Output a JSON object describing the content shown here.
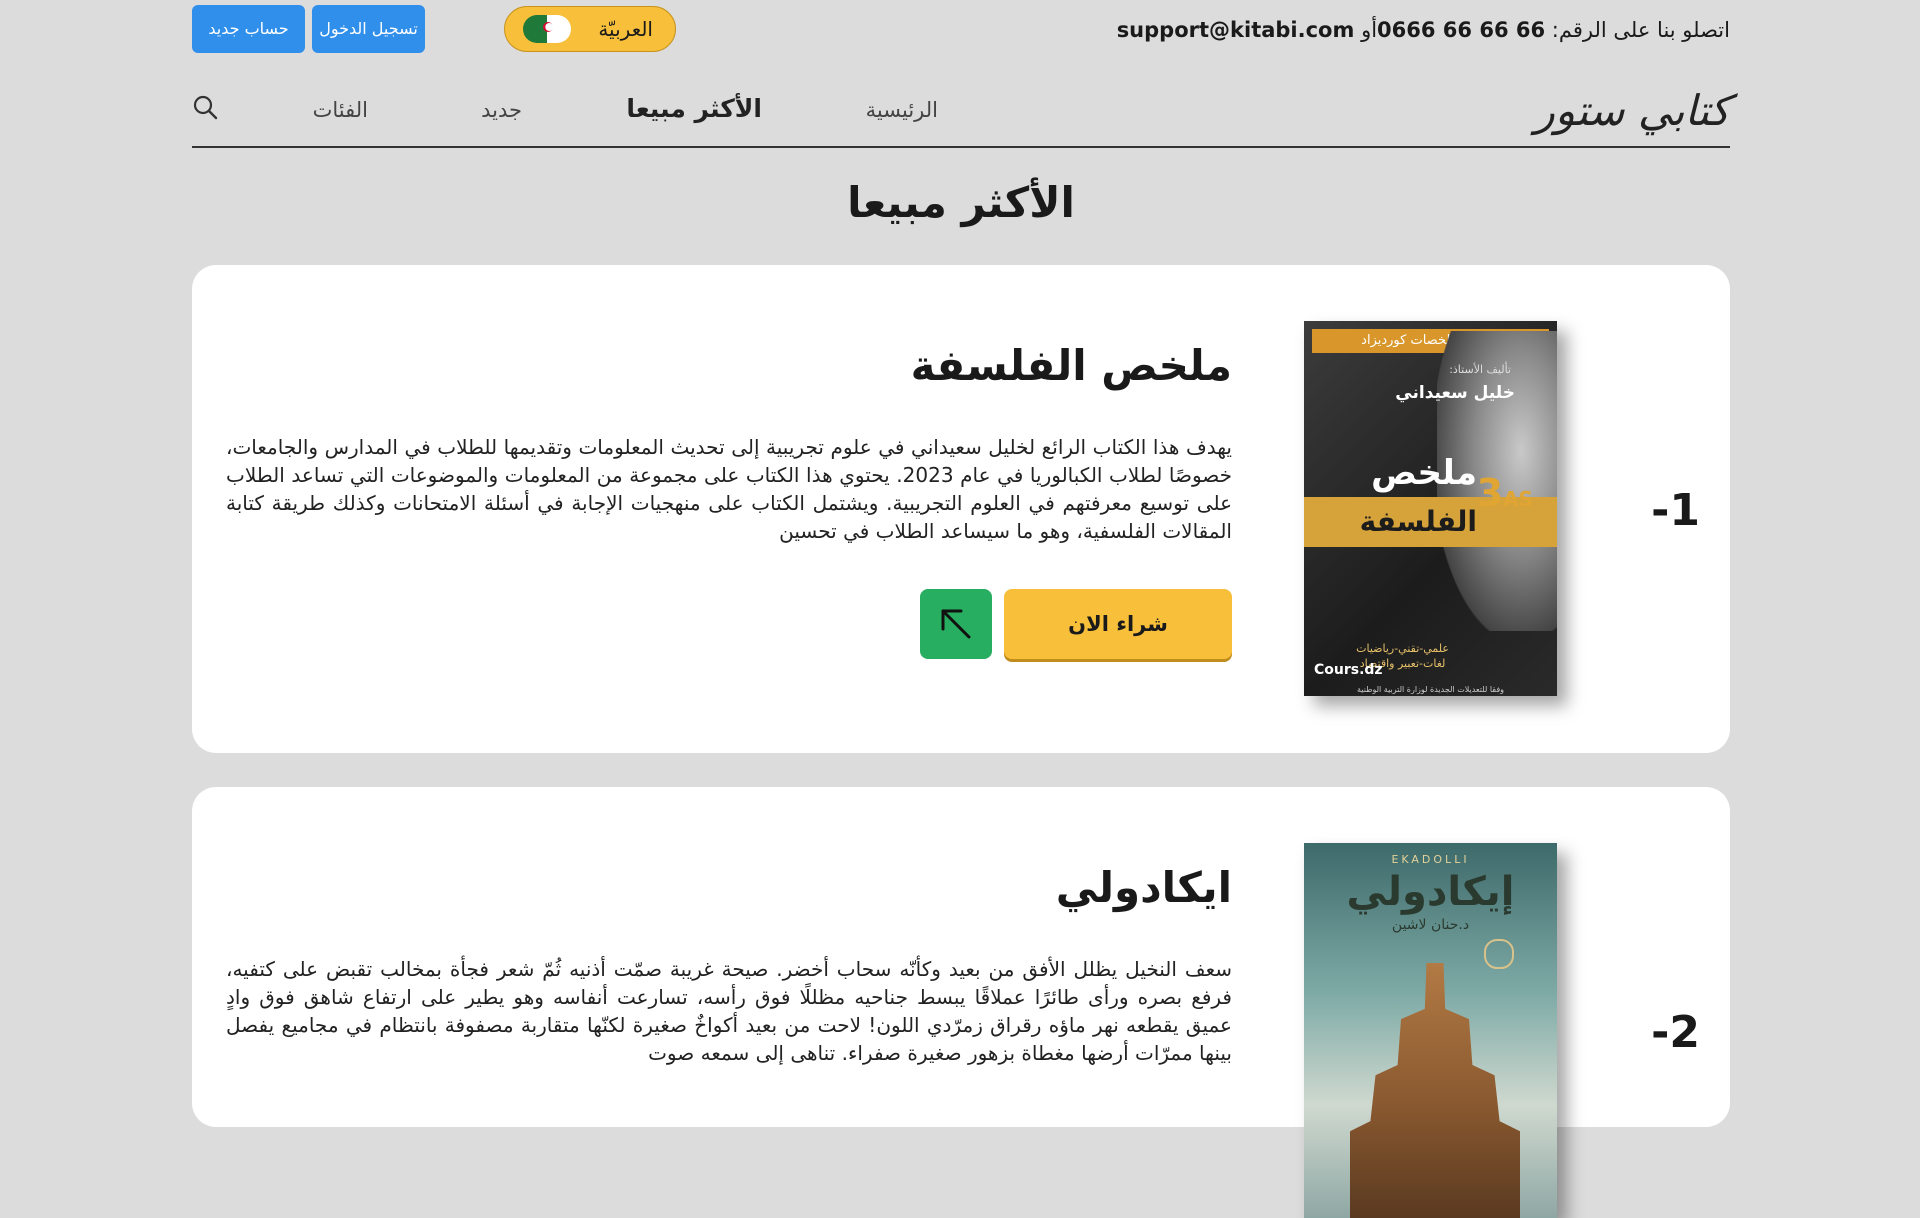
{
  "contact": {
    "prefix": "اتصلو بنا على الرقم:",
    "phone": "0666 66 66 66",
    "or": "أو",
    "email": "support@kitabi.com"
  },
  "language": {
    "label": "العربيّة",
    "flag_icon": "algeria-flag-icon"
  },
  "auth": {
    "login": "تسجيل الدخول",
    "register": "حساب جديد"
  },
  "nav": {
    "logo": "كتابي ستور",
    "items": [
      {
        "label": "الرئيسية"
      },
      {
        "label": "الأكثر مبيعا"
      },
      {
        "label": "جديد"
      },
      {
        "label": "الفئات"
      }
    ],
    "search_icon": "search-icon"
  },
  "page_title": "الأكثر مبيعا",
  "books": [
    {
      "rank": "-1",
      "title": "ملخص الفلسفة",
      "description": "يهدف هذا الكتاب الرائع لخليل سعيداني في علوم تجريبية إلى تحديث المعلومات وتقديمها للطلاب في المدارس والجامعات، خصوصًا لطلاب الكبالوريا في عام 2023. يحتوي هذا الكتاب على مجموعة من المعلومات والموضوعات التي تساعد الطلاب على توسيع معرفتهم في العلوم التجريبية. ويشتمل الكتاب على منهجيات الإجابة في أسئلة الامتحانات وكذلك طريقة كتابة المقالات الفلسفية، وهو ما سيساعد الطلاب في تحسين",
      "buy_label": "شراء الان",
      "cover": {
        "series": "سلسلة ملخصات كورديزاد",
        "author_label": "تأليف الأستاذ:",
        "author": "خليل سعيداني",
        "title_top": "ملخص",
        "title_bottom": "الفلسفة",
        "level": "3",
        "level_suffix": "AS",
        "branches": "علمي-تقني-رياضيات\nلغات-تعبير واقتصاد",
        "brand": "Cours.dz",
        "footer": "وفقا للتعديلات الجديدة لوزارة التربية الوطنية"
      }
    },
    {
      "rank": "-2",
      "title": "ايكادولي",
      "description": "سعف النخيل يظلل الأفق من بعيد وكأنّه سحاب أخضر. صيحة غريبة صمّت أذنيه ثُمّ شعر فجأة بمخالب تقبض على كتفيه، فرفع بصره ورأى طائرًا عملاقًا يبسط جناحيه مظللًا فوق رأسه، تسارعت أنفاسه وهو يطير على ارتفاع شاهق فوق وادٍ عميق يقطعه نهر ماؤه رقراق زمرّدي اللون! لاحت من بعيد أكواخٌ صغيرة لكنّها متقاربة مصفوفة بانتظام في مجاميع يفصل بينها ممرّات أرضها مغطاة بزهور صغيرة صفراء. تناهى إلى سمعه صوت",
      "cover": {
        "latin": "EKADOLLI",
        "title": "إيكادولي",
        "author": "د.حنان لاشين"
      }
    }
  ]
}
